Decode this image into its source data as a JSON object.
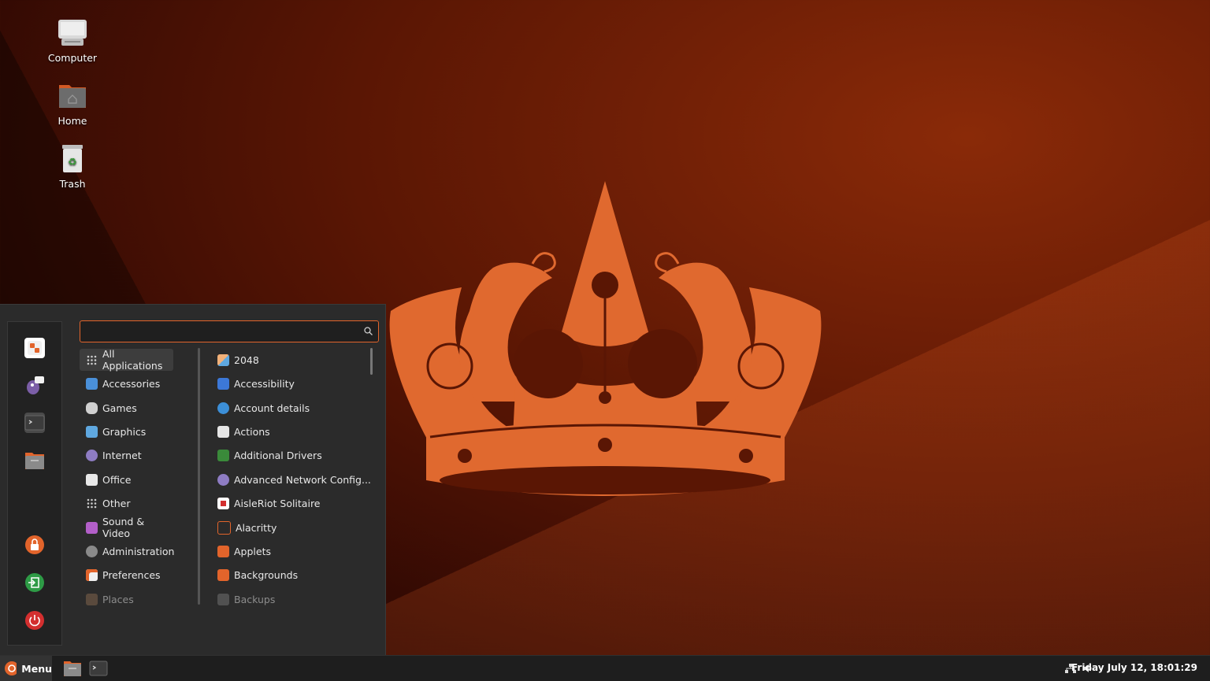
{
  "desktop": {
    "icons": [
      {
        "label": "Computer"
      },
      {
        "label": "Home"
      },
      {
        "label": "Trash"
      }
    ]
  },
  "menu": {
    "search": {
      "value": "",
      "placeholder": ""
    },
    "favorites": [
      "settings-icon",
      "pidgin-icon",
      "terminal-icon",
      "files-icon",
      "lock-icon",
      "logout-icon",
      "power-icon"
    ],
    "categories": [
      {
        "label": "All Applications"
      },
      {
        "label": "Accessories"
      },
      {
        "label": "Games"
      },
      {
        "label": "Graphics"
      },
      {
        "label": "Internet"
      },
      {
        "label": "Office"
      },
      {
        "label": "Other"
      },
      {
        "label": "Sound & Video"
      },
      {
        "label": "Administration"
      },
      {
        "label": "Preferences"
      },
      {
        "label": "Places"
      }
    ],
    "apps": [
      {
        "label": "2048"
      },
      {
        "label": "Accessibility"
      },
      {
        "label": "Account details"
      },
      {
        "label": "Actions"
      },
      {
        "label": "Additional Drivers"
      },
      {
        "label": "Advanced Network Config..."
      },
      {
        "label": "AisleRiot Solitaire"
      },
      {
        "label": "Alacritty"
      },
      {
        "label": "Applets"
      },
      {
        "label": "Backgrounds"
      },
      {
        "label": "Backups"
      }
    ]
  },
  "panel": {
    "menu_label": "Menu",
    "clock": "Friday July 12, 18:01:29"
  },
  "colors": {
    "accent": "#e2642b",
    "crown": "#e0692f"
  }
}
